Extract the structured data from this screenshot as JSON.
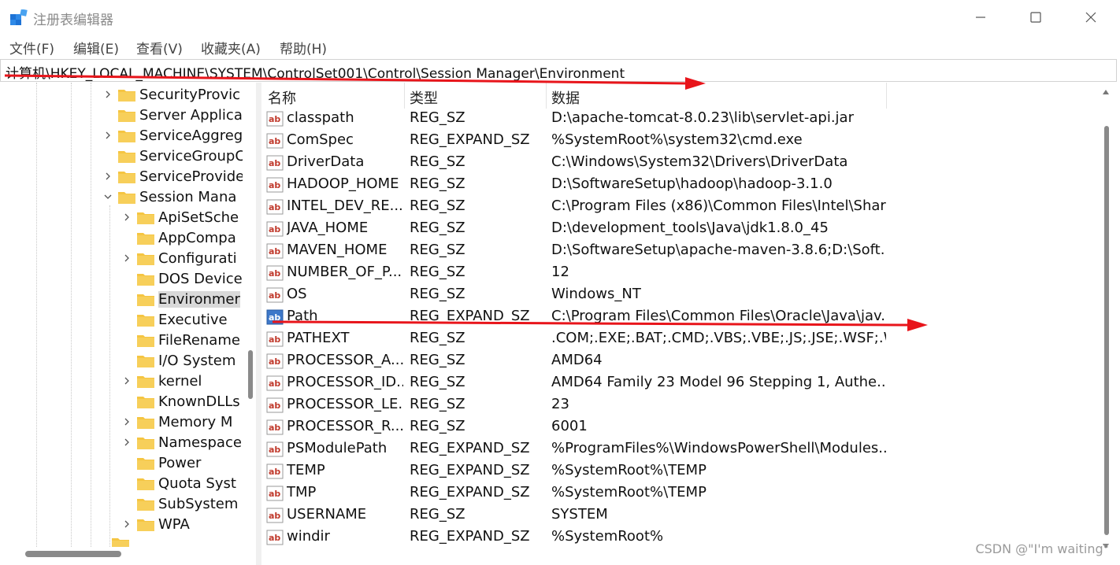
{
  "window": {
    "title": "注册表编辑器",
    "controls": {
      "minimize_icon": "minimize-icon",
      "maximize_icon": "maximize-icon",
      "close_icon": "close-icon"
    }
  },
  "menu": [
    "文件(F)",
    "编辑(E)",
    "查看(V)",
    "收藏夹(A)",
    "帮助(H)"
  ],
  "address": "计算机\\HKEY_LOCAL_MACHINE\\SYSTEM\\ControlSet001\\Control\\Session Manager\\Environment",
  "tree": [
    {
      "label": "SecurityProvic",
      "level": 1,
      "expandable": true,
      "expanded": false
    },
    {
      "label": "Server Applica",
      "level": 1,
      "expandable": false,
      "expanded": false
    },
    {
      "label": "ServiceAggreg",
      "level": 1,
      "expandable": true,
      "expanded": false
    },
    {
      "label": "ServiceGroupC",
      "level": 1,
      "expandable": false,
      "expanded": false
    },
    {
      "label": "ServiceProvide",
      "level": 1,
      "expandable": true,
      "expanded": false
    },
    {
      "label": "Session Mana",
      "level": 1,
      "expandable": true,
      "expanded": true
    },
    {
      "label": "ApiSetSche",
      "level": 2,
      "expandable": true,
      "expanded": false
    },
    {
      "label": "AppCompa",
      "level": 2,
      "expandable": false,
      "expanded": false
    },
    {
      "label": "Configurati",
      "level": 2,
      "expandable": true,
      "expanded": false
    },
    {
      "label": "DOS Device",
      "level": 2,
      "expandable": false,
      "expanded": false
    },
    {
      "label": "Environmer",
      "level": 2,
      "expandable": false,
      "expanded": false,
      "selected": true
    },
    {
      "label": "Executive",
      "level": 2,
      "expandable": false,
      "expanded": false
    },
    {
      "label": "FileRename",
      "level": 2,
      "expandable": false,
      "expanded": false
    },
    {
      "label": "I/O System",
      "level": 2,
      "expandable": false,
      "expanded": false
    },
    {
      "label": "kernel",
      "level": 2,
      "expandable": true,
      "expanded": false
    },
    {
      "label": "KnownDLLs",
      "level": 2,
      "expandable": false,
      "expanded": false
    },
    {
      "label": "Memory M",
      "level": 2,
      "expandable": true,
      "expanded": false
    },
    {
      "label": "Namespace",
      "level": 2,
      "expandable": true,
      "expanded": false
    },
    {
      "label": "Power",
      "level": 2,
      "expandable": false,
      "expanded": false
    },
    {
      "label": "Quota Syst",
      "level": 2,
      "expandable": false,
      "expanded": false
    },
    {
      "label": "SubSystem",
      "level": 2,
      "expandable": false,
      "expanded": false
    },
    {
      "label": "WPA",
      "level": 2,
      "expandable": true,
      "expanded": false
    }
  ],
  "columns": {
    "name": "名称",
    "type": "类型",
    "data": "数据"
  },
  "values": [
    {
      "name": "classpath",
      "type": "REG_SZ",
      "data": "D:\\apache-tomcat-8.0.23\\lib\\servlet-api.jar"
    },
    {
      "name": "ComSpec",
      "type": "REG_EXPAND_SZ",
      "data": "%SystemRoot%\\system32\\cmd.exe"
    },
    {
      "name": "DriverData",
      "type": "REG_SZ",
      "data": "C:\\Windows\\System32\\Drivers\\DriverData"
    },
    {
      "name": "HADOOP_HOME",
      "type": "REG_SZ",
      "data": "D:\\SoftwareSetup\\hadoop\\hadoop-3.1.0"
    },
    {
      "name": "INTEL_DEV_RE...",
      "type": "REG_SZ",
      "data": "C:\\Program Files (x86)\\Common Files\\Intel\\Shar..."
    },
    {
      "name": "JAVA_HOME",
      "type": "REG_SZ",
      "data": "D:\\development_tools\\Java\\jdk1.8.0_45"
    },
    {
      "name": "MAVEN_HOME",
      "type": "REG_SZ",
      "data": "D:\\SoftwareSetup\\apache-maven-3.8.6;D:\\Soft..."
    },
    {
      "name": "NUMBER_OF_P...",
      "type": "REG_SZ",
      "data": "12"
    },
    {
      "name": "OS",
      "type": "REG_SZ",
      "data": "Windows_NT"
    },
    {
      "name": "Path",
      "type": "REG_EXPAND_SZ",
      "data": "C:\\Program Files\\Common Files\\Oracle\\Java\\jav...",
      "icon": "selected"
    },
    {
      "name": "PATHEXT",
      "type": "REG_SZ",
      "data": ".COM;.EXE;.BAT;.CMD;.VBS;.VBE;.JS;.JSE;.WSF;.WS..."
    },
    {
      "name": "PROCESSOR_A...",
      "type": "REG_SZ",
      "data": "AMD64"
    },
    {
      "name": "PROCESSOR_ID...",
      "type": "REG_SZ",
      "data": "AMD64 Family 23 Model 96 Stepping 1, Authe..."
    },
    {
      "name": "PROCESSOR_LE...",
      "type": "REG_SZ",
      "data": "23"
    },
    {
      "name": "PROCESSOR_R...",
      "type": "REG_SZ",
      "data": "6001"
    },
    {
      "name": "PSModulePath",
      "type": "REG_EXPAND_SZ",
      "data": "%ProgramFiles%\\WindowsPowerShell\\Modules..."
    },
    {
      "name": "TEMP",
      "type": "REG_EXPAND_SZ",
      "data": "%SystemRoot%\\TEMP"
    },
    {
      "name": "TMP",
      "type": "REG_EXPAND_SZ",
      "data": "%SystemRoot%\\TEMP"
    },
    {
      "name": "USERNAME",
      "type": "REG_SZ",
      "data": "SYSTEM"
    },
    {
      "name": "windir",
      "type": "REG_EXPAND_SZ",
      "data": "%SystemRoot%"
    }
  ],
  "watermark": "CSDN @\"I'm waiting\"",
  "colors": {
    "annotation_red": "#e8151b",
    "folder_yellow": "#f5c542",
    "reg_icon_red": "#c0392b",
    "selected_bg": "#d9d9d9"
  }
}
